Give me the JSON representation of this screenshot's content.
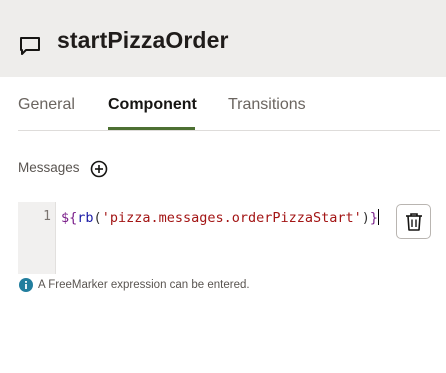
{
  "header": {
    "title": "startPizzaOrder",
    "icon": "chat-bubble-icon"
  },
  "tabs": [
    {
      "label": "General",
      "active": false
    },
    {
      "label": "Component",
      "active": true
    },
    {
      "label": "Transitions",
      "active": false
    }
  ],
  "messages": {
    "label": "Messages",
    "add_icon": "plus-circle-icon"
  },
  "editor": {
    "line_number": "1",
    "code_tokens": {
      "dollar": "$",
      "brace_open": "{",
      "fn": "rb",
      "paren_open": "(",
      "string": "'pizza.messages.orderPizzaStart'",
      "paren_close": ")",
      "brace_close": "}"
    },
    "delete_icon": "trash-icon"
  },
  "hint": {
    "icon": "info-icon",
    "text": "A FreeMarker expression can be entered."
  },
  "colors": {
    "accent": "#4d7032",
    "header_bg": "#eeedeb",
    "info": "#227e9e"
  }
}
